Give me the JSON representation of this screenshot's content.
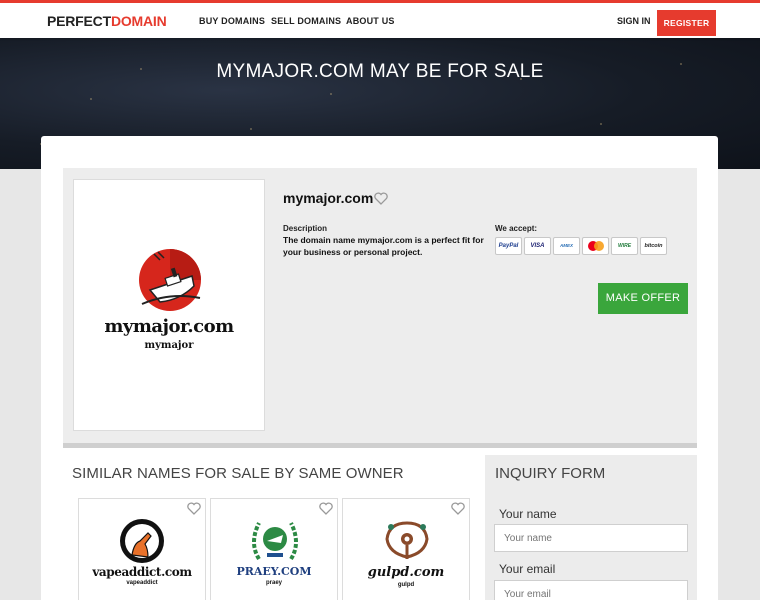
{
  "header": {
    "logo_part1": "PERFECT",
    "logo_part2": "DOMAIN",
    "nav": [
      "BUY DOMAINS",
      "SELL DOMAINS",
      "ABOUT US"
    ],
    "sign_in": "SIGN IN",
    "register": "REGISTER"
  },
  "hero": {
    "title": "MYMAJOR.COM MAY BE FOR SALE"
  },
  "listing": {
    "domain": "mymajor.com",
    "logo_text": "mymajor.com",
    "logo_subtext": "mymajor",
    "description_label": "Description",
    "description": "The domain name mymajor.com is a perfect fit for your business or personal project.",
    "accept_label": "We accept:",
    "payments": [
      "PayPal",
      "VISA",
      "AMEX",
      "MC",
      "WIRE",
      "bitcoin"
    ],
    "make_offer": "MAKE OFFER"
  },
  "similar": {
    "title": "SIMILAR NAMES FOR SALE BY SAME OWNER",
    "items": [
      {
        "name": "vapeaddict.com",
        "sub": "vapeaddict"
      },
      {
        "name": "PRAEY.COM",
        "sub": "praey"
      },
      {
        "name": "gulpd.com",
        "sub": "gulpd"
      }
    ]
  },
  "inquiry": {
    "title": "INQUIRY FORM",
    "name_label": "Your name",
    "name_placeholder": "Your name",
    "email_label": "Your email",
    "email_placeholder": "Your email"
  },
  "colors": {
    "brand_red": "#e63b2e",
    "offer_green": "#3aa63c"
  }
}
